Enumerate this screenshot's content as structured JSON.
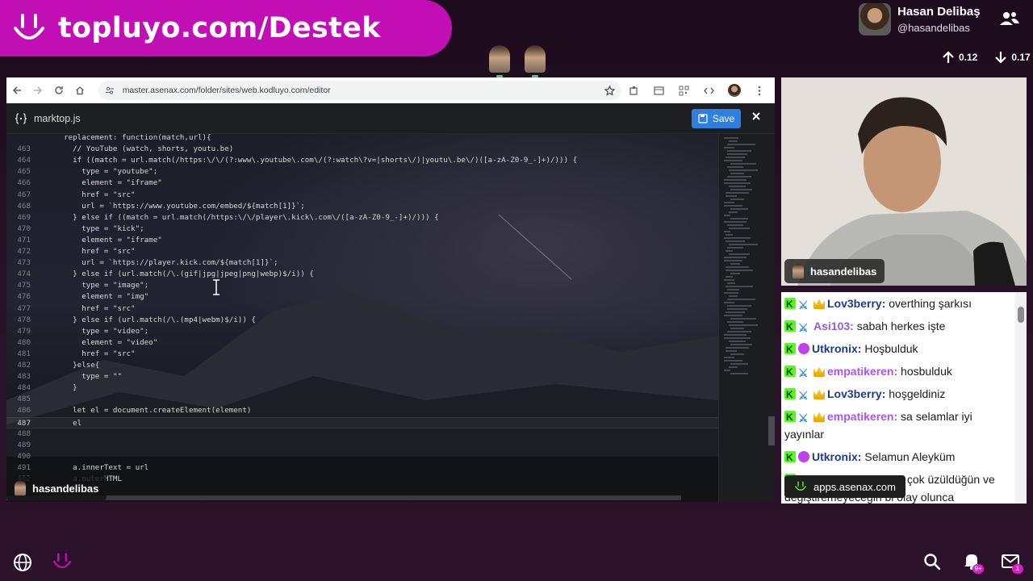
{
  "banner": {
    "text": "topluyo.com/Destek"
  },
  "profile": {
    "name": "Hasan Delibaş",
    "handle": "@hasandelibas"
  },
  "stats": {
    "up": "0.12",
    "down": "0.17"
  },
  "browser": {
    "url": "master.asenax.com/folder/sites/web.kodluyo.com/editor",
    "file_name": "marktop.js",
    "save_label": "Save",
    "code_lines": [
      {
        "n": "",
        "t": "  replacement: function(match,url){"
      },
      {
        "n": "463",
        "t": "    // YouTube (watch, shorts, youtu.be)"
      },
      {
        "n": "464",
        "t": "    if ((match = url.match(/https:\\/\\/(?:www\\.youtube\\.com\\/(?:watch\\?v=|shorts\\/)|youtu\\.be\\/)([a-zA-Z0-9_-]+)/))) {"
      },
      {
        "n": "465",
        "t": "      type = \"youtube\";"
      },
      {
        "n": "466",
        "t": "      element = \"iframe\""
      },
      {
        "n": "467",
        "t": "      href = \"src\""
      },
      {
        "n": "468",
        "t": "      url = `https://www.youtube.com/embed/${match[1]}`;"
      },
      {
        "n": "469",
        "t": "    } else if ((match = url.match(/https:\\/\\/player\\.kick\\.com\\/([a-zA-Z0-9_-]+)/))) {"
      },
      {
        "n": "470",
        "t": "      type = \"kick\";"
      },
      {
        "n": "471",
        "t": "      element = \"iframe\""
      },
      {
        "n": "472",
        "t": "      href = \"src\""
      },
      {
        "n": "473",
        "t": "      url = `https://player.kick.com/${match[1]}`;"
      },
      {
        "n": "474",
        "t": "    } else if (url.match(/\\.(gif|jpg|jpeg|png|webp)$/i)) {"
      },
      {
        "n": "475",
        "t": "      type = \"image\";"
      },
      {
        "n": "476",
        "t": "      element = \"img\""
      },
      {
        "n": "477",
        "t": "      href = \"src\""
      },
      {
        "n": "478",
        "t": "    } else if (url.match(/\\.(mp4|webm)$/i)) {"
      },
      {
        "n": "479",
        "t": "      type = \"video\";"
      },
      {
        "n": "480",
        "t": "      element = \"video\""
      },
      {
        "n": "481",
        "t": "      href = \"src\""
      },
      {
        "n": "482",
        "t": "    }else{"
      },
      {
        "n": "483",
        "t": "      type = \"\""
      },
      {
        "n": "484",
        "t": "    }"
      },
      {
        "n": "485",
        "t": ""
      },
      {
        "n": "486",
        "t": "    let el = document.createElement(element)"
      },
      {
        "n": "487",
        "t": "    el"
      },
      {
        "n": "488",
        "t": ""
      },
      {
        "n": "489",
        "t": ""
      },
      {
        "n": "490",
        "t": ""
      },
      {
        "n": "491",
        "t": "    a.innerText = url"
      },
      {
        "n": "492",
        "t": "    a.outerHTML"
      }
    ],
    "streamer_tag": "hasandelibas"
  },
  "webcam": {
    "tag": "hasandelibas"
  },
  "chat": {
    "messages": [
      {
        "badges": [
          "kick",
          "sword",
          "crown"
        ],
        "user": "Lov3berry",
        "color": "#1e3a8a",
        "text": "overthing şarkısı"
      },
      {
        "badges": [
          "kick",
          "sword"
        ],
        "user": "Asi103",
        "color": "#8b5cf6",
        "text": "sabah herkes işte"
      },
      {
        "badges": [
          "kick",
          "sub"
        ],
        "user": "Utkronix",
        "color": "#1e3a8a",
        "text": "Hoşbulduk"
      },
      {
        "badges": [
          "kick",
          "sword",
          "crown"
        ],
        "user": "empatikeren",
        "color": "#a855f7",
        "text": "hosbulduk"
      },
      {
        "badges": [
          "kick",
          "sword",
          "crown"
        ],
        "user": "Lov3berry",
        "color": "#1e3a8a",
        "text": "hoşgeldiniz"
      },
      {
        "badges": [
          "kick",
          "sword",
          "crown"
        ],
        "user": "empatikeren",
        "color": "#a855f7",
        "text": "sa selamlar iyi yayınlar"
      },
      {
        "badges": [
          "kick",
          "sub"
        ],
        "user": "Utkronix",
        "color": "#1e3a8a",
        "text": "Selamun Aleyküm"
      },
      {
        "badges": [
          "kick",
          "sword",
          "crown"
        ],
        "user": "Lov3berry",
        "color": "#1e3a8a",
        "text": "abi çok üzüldüğün ve değiştiremeyeceğin bi olay olunca"
      }
    ],
    "apps_tag": "apps.asenax.com"
  },
  "bottom": {
    "bell_badge": "9+",
    "mail_badge": "1"
  },
  "colors": {
    "brand": "#c20fb5",
    "save": "#2f7fe0",
    "kick": "#53fc18"
  },
  "icons": [
    "smile-logo-icon",
    "people-icon",
    "arrow-up-icon",
    "arrow-down-icon",
    "globe-icon",
    "search-icon",
    "bell-icon",
    "mail-icon"
  ]
}
